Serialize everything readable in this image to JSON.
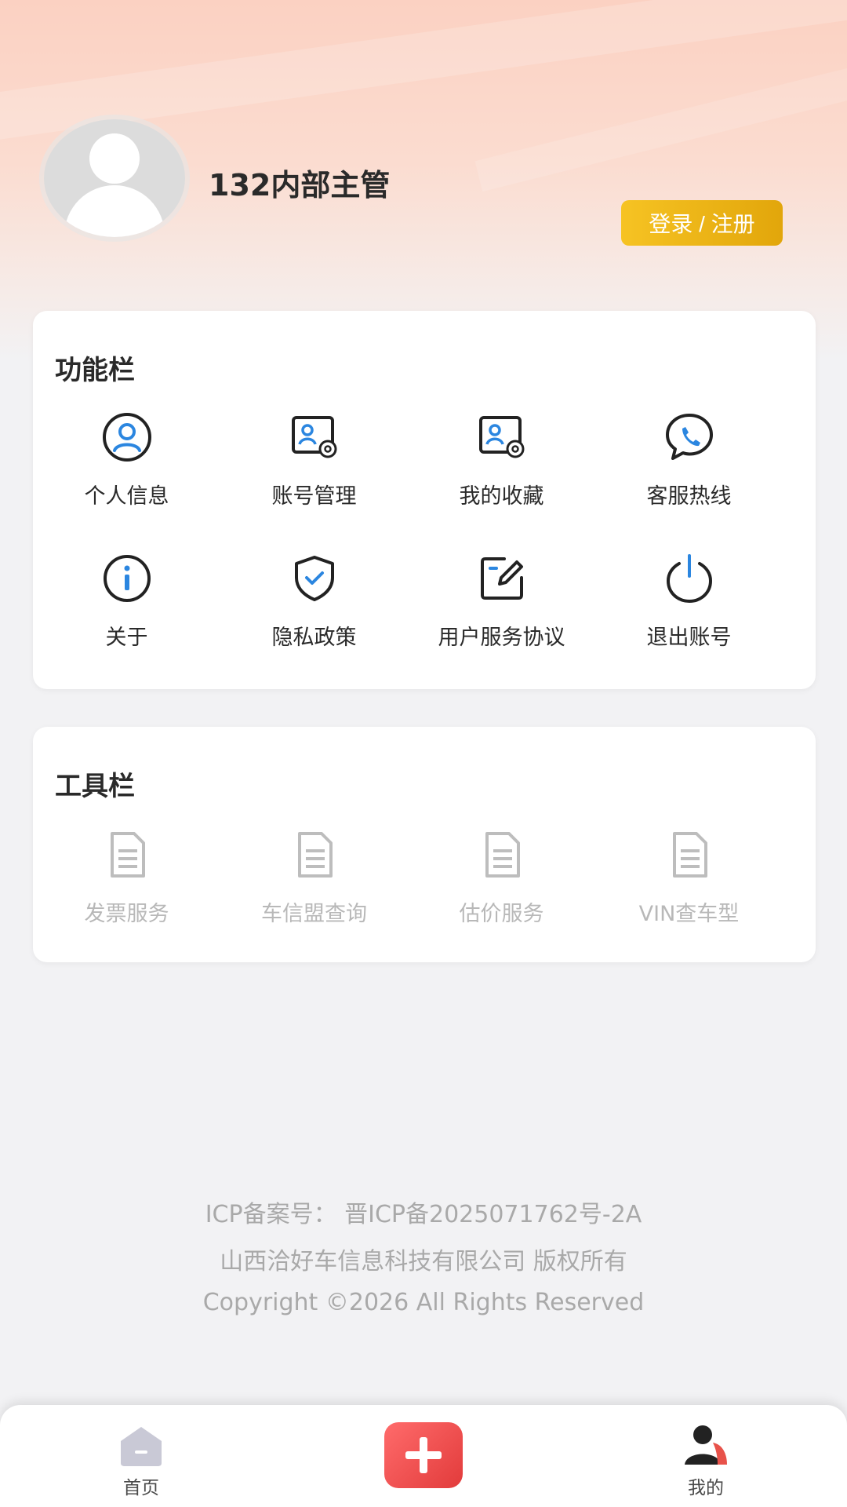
{
  "profile": {
    "username": "132内部主管",
    "login_label": "登录 / 注册"
  },
  "function_section": {
    "title": "功能栏",
    "items": [
      {
        "label": "个人信息",
        "icon": "user-circle-icon"
      },
      {
        "label": "账号管理",
        "icon": "account-settings-icon"
      },
      {
        "label": "我的收藏",
        "icon": "favorites-icon"
      },
      {
        "label": "客服热线",
        "icon": "phone-chat-icon"
      },
      {
        "label": "关于",
        "icon": "info-icon"
      },
      {
        "label": "隐私政策",
        "icon": "shield-check-icon"
      },
      {
        "label": "用户服务协议",
        "icon": "edit-document-icon"
      },
      {
        "label": "退出账号",
        "icon": "power-icon"
      }
    ]
  },
  "tools_section": {
    "title": "工具栏",
    "items": [
      {
        "label": "发票服务",
        "icon": "document-icon"
      },
      {
        "label": "车信盟查询",
        "icon": "document-icon"
      },
      {
        "label": "估价服务",
        "icon": "document-icon"
      },
      {
        "label": "VIN查车型",
        "icon": "document-icon"
      }
    ]
  },
  "footer": {
    "icp": "ICP备案号：  晋ICP备2025071762号-2A",
    "company": "山西洽好车信息科技有限公司 版权所有",
    "copyright": "Copyright ©2026 All Rights Reserved"
  },
  "bottom_nav": {
    "home_label": "首页",
    "mine_label": "我的"
  },
  "colors": {
    "accent_blue": "#2b86e0",
    "login_yellow": "#f2b818",
    "plus_red": "#e84545"
  }
}
